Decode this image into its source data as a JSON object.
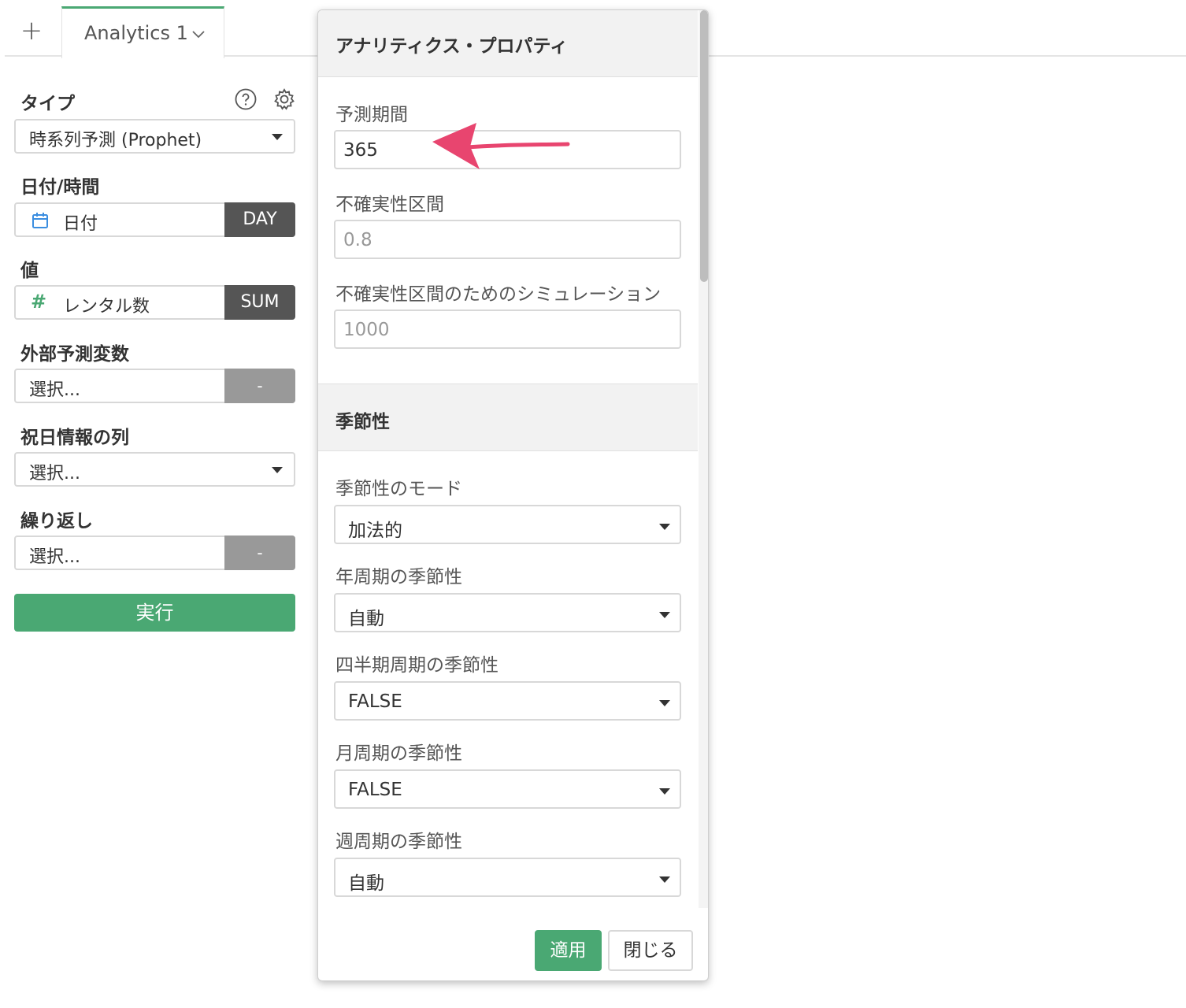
{
  "tabbar": {
    "add_label": "+",
    "tab_label": "Analytics 1"
  },
  "left": {
    "type_label": "タイプ",
    "type_value": "時系列予測 (Prophet)",
    "date_label": "日付/時間",
    "date_value": "日付",
    "date_agg": "DAY",
    "value_label": "値",
    "value_value": "レンタル数",
    "value_agg": "SUM",
    "external_label": "外部予測変数",
    "external_value": "選択...",
    "external_agg": "-",
    "holiday_label": "祝日情報の列",
    "holiday_value": "選択...",
    "repeat_label": "繰り返し",
    "repeat_value": "選択...",
    "repeat_agg": "-",
    "run_label": "実行"
  },
  "popover": {
    "title": "アナリティクス・プロパティ",
    "forecast_period_label": "予測期間",
    "forecast_period_value": "365",
    "uncertainty_label": "不確実性区間",
    "uncertainty_placeholder": "0.8",
    "simulation_label": "不確実性区間のためのシミュレーション",
    "simulation_placeholder": "1000",
    "seasonality_section": "季節性",
    "season_mode_label": "季節性のモード",
    "season_mode_value": "加法的",
    "yearly_label": "年周期の季節性",
    "yearly_value": "自動",
    "quarterly_label": "四半期周期の季節性",
    "quarterly_value": "FALSE",
    "monthly_label": "月周期の季節性",
    "monthly_value": "FALSE",
    "weekly_label": "週周期の季節性",
    "weekly_value": "自動",
    "apply_label": "適用",
    "close_label": "閉じる"
  },
  "colors": {
    "accent": "#4aa873",
    "annotation": "#e8456f",
    "dark_tag": "#555555",
    "grey_tag": "#999999"
  },
  "icons": [
    "plus-icon",
    "chevron-down-icon",
    "help-icon",
    "gear-icon",
    "calendar-icon",
    "hash-icon",
    "caret-down-icon",
    "annotation-arrow"
  ]
}
